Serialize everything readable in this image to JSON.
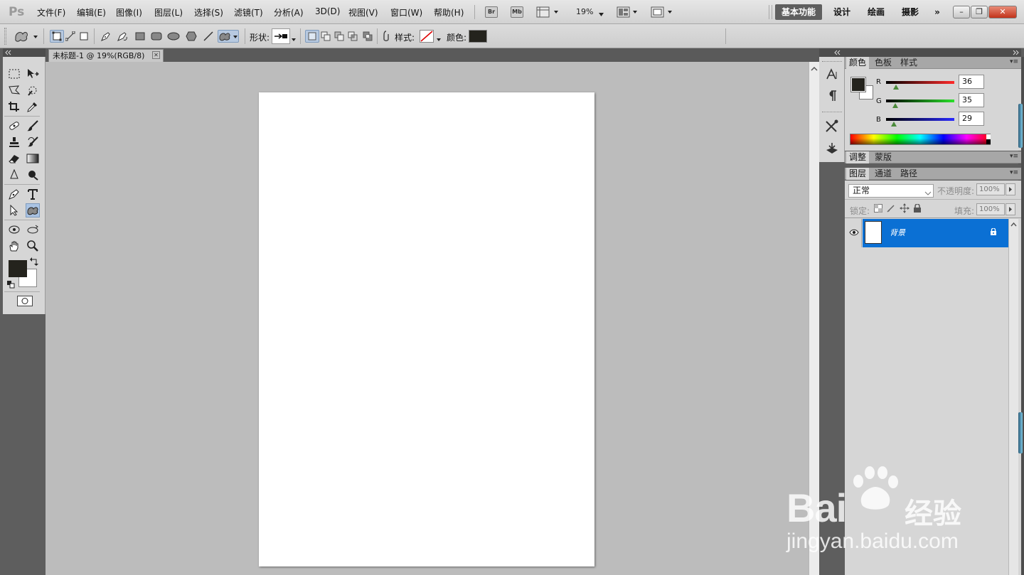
{
  "app": {
    "logo": "Ps"
  },
  "menu": [
    {
      "label": "文件(F)"
    },
    {
      "label": "编辑(E)"
    },
    {
      "label": "图像(I)"
    },
    {
      "label": "图层(L)"
    },
    {
      "label": "选择(S)"
    },
    {
      "label": "滤镜(T)"
    },
    {
      "label": "分析(A)"
    },
    {
      "label": "3D(D)"
    },
    {
      "label": "视图(V)"
    },
    {
      "label": "窗口(W)"
    },
    {
      "label": "帮助(H)"
    }
  ],
  "appbar": {
    "bridge": "Br",
    "minibridge": "Mb",
    "zoom": "19%"
  },
  "workspaces": [
    {
      "label": "基本功能",
      "active": true
    },
    {
      "label": "设计"
    },
    {
      "label": "绘画"
    },
    {
      "label": "摄影"
    },
    {
      "label": "»"
    }
  ],
  "window_controls": {
    "minimize": "–",
    "restore": "❐",
    "close": "✕"
  },
  "options": {
    "shape_label": "形状:",
    "style_label": "样式:",
    "color_label": "颜色:",
    "color_value": "#24231d"
  },
  "document": {
    "tab_title": "未标题-1 @ 19%(RGB/8)",
    "close": "✕"
  },
  "color_panel": {
    "tabs": [
      {
        "label": "颜色",
        "active": true
      },
      {
        "label": "色板"
      },
      {
        "label": "样式"
      }
    ],
    "foreground": "#24231d",
    "background": "#ffffff",
    "channels": [
      {
        "name": "R",
        "value": "36",
        "gradient": "#ff2a2a"
      },
      {
        "name": "G",
        "value": "35",
        "gradient": "#2ae02a"
      },
      {
        "name": "B",
        "value": "29",
        "gradient": "#2a2aff"
      }
    ]
  },
  "adjust_panel": {
    "tabs": [
      {
        "label": "调整",
        "active": true
      },
      {
        "label": "蒙版"
      }
    ]
  },
  "layers_panel": {
    "tabs": [
      {
        "label": "图层",
        "active": true
      },
      {
        "label": "通道"
      },
      {
        "label": "路径"
      }
    ],
    "blend_mode": "正常",
    "opacity_label": "不透明度:",
    "opacity_value": "100%",
    "lock_label": "锁定:",
    "fill_label": "填充:",
    "fill_value": "100%",
    "layers": [
      {
        "name": "背景",
        "selected": true,
        "locked": true,
        "visible": true
      }
    ]
  },
  "watermark": {
    "main": "Bai",
    "cn": "经验",
    "url": "jingyan.baidu.com"
  }
}
